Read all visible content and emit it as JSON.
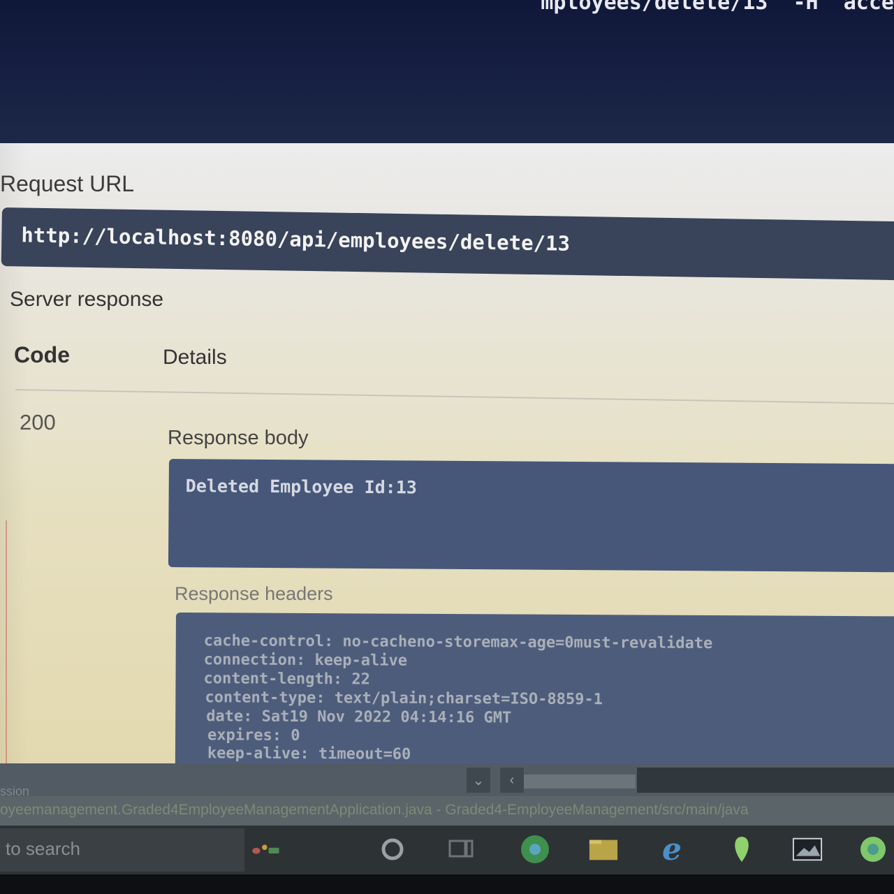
{
  "curl": {
    "fragment": "mployees/delete/13\" -H \"acce"
  },
  "request_url": {
    "label": "Request URL",
    "value": "http://localhost:8080/api/employees/delete/13"
  },
  "server_response": {
    "label": "Server response",
    "columns": {
      "code": "Code",
      "details": "Details"
    },
    "code": "200",
    "body_label": "Response body",
    "body": "Deleted Employee Id:13",
    "headers_label": "Response headers",
    "headers": [
      "cache-control: no-cacheno-storemax-age=0must-revalidate",
      "connection: keep-alive",
      "content-length: 22",
      "content-type: text/plain;charset=ISO-8859-1",
      "date: Sat19 Nov 2022 04:14:16 GMT",
      "expires: 0",
      "keep-alive: timeout=60"
    ]
  },
  "editor": {
    "clipped_label": "ssion",
    "status_path": "oyeemanagement.Graded4EmployeeManagementApplication.java - Graded4-EmployeeManagement/src/main/java"
  },
  "taskbar": {
    "search_placeholder": "to search",
    "icons": [
      "apps-icon",
      "cortana-icon",
      "task-view-icon",
      "chrome-icon",
      "file-explorer-icon",
      "edge-icon",
      "maps-icon",
      "photos-icon",
      "app-icon"
    ]
  }
}
